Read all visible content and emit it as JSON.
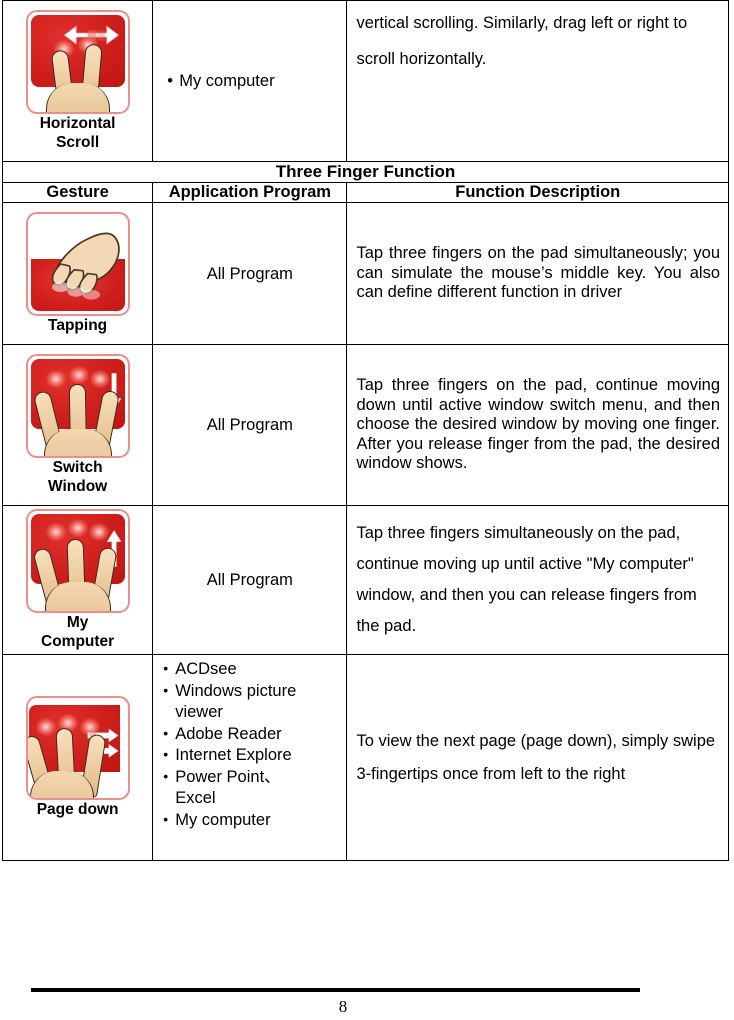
{
  "document": {
    "page_number": "8"
  },
  "table": {
    "columns": {
      "gesture": "Gesture",
      "application_program": "Application Program",
      "function_description": "Function Description"
    },
    "section_title": "Three Finger Function",
    "top_row": {
      "gesture_label_line1": "Horizontal",
      "gesture_label_line2": "Scroll",
      "gesture_icon": "two-finger-horizontal-scroll-icon",
      "application_bullet": "My computer",
      "description": "vertical scrolling. Similarly, drag left or right to scroll horizontally."
    },
    "rows": [
      {
        "gesture_label": "Tapping",
        "gesture_icon": "three-finger-tap-icon",
        "application": "All Program",
        "description": "Tap three fingers on the pad simultaneously; you can simulate the mouse’s middle key. You also can define different function in driver"
      },
      {
        "gesture_label_line1": "Switch",
        "gesture_label_line2": "Window",
        "gesture_icon": "three-finger-swipe-down-icon",
        "application": "All Program",
        "description": "Tap three fingers on the pad, continue moving down until active window switch menu, and then choose the desired window by moving one finger. After you release finger from the pad, the desired window shows."
      },
      {
        "gesture_label_line1": "My",
        "gesture_label_line2": "Computer",
        "gesture_icon": "three-finger-swipe-up-icon",
        "application": "All Program",
        "description": "Tap three fingers simultaneously on the pad, continue moving up until active \"My computer\" window, and then you can release fingers from the pad."
      },
      {
        "gesture_label": "Page down",
        "gesture_icon": "three-finger-swipe-right-icon",
        "application_list": [
          "ACDsee",
          "Windows picture viewer",
          "Adobe Reader",
          "Internet Explore",
          "Power Point、Excel",
          "My computer"
        ],
        "description": "To view the next page (page down), simply swipe 3-fingertips once from left to the right"
      }
    ]
  },
  "colors": {
    "pad_red": "#cf1f1c",
    "pad_border": "#e8908f",
    "skin": "#eccb9f",
    "text": "#000000"
  }
}
